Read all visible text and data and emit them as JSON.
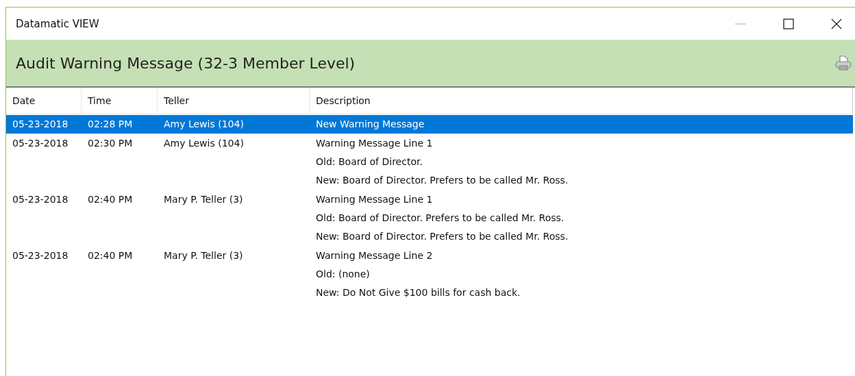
{
  "window": {
    "title": "Datamatic VIEW"
  },
  "header": {
    "title": "Audit Warning Message (32-3 Member Level)"
  },
  "table": {
    "columns": [
      "Date",
      "Time",
      "Teller",
      "Description"
    ],
    "rows": [
      {
        "date": "05-23-2018",
        "time": "02:28 PM",
        "teller": "Amy Lewis (104)",
        "description": [
          "New Warning Message"
        ],
        "selected": true
      },
      {
        "date": "05-23-2018",
        "time": "02:30 PM",
        "teller": "Amy Lewis (104)",
        "description": [
          "Warning Message Line 1",
          "Old: Board of Director.",
          "New: Board of Director. Prefers to be called Mr. Ross."
        ],
        "selected": false
      },
      {
        "date": "05-23-2018",
        "time": "02:40 PM",
        "teller": "Mary P. Teller (3)",
        "description": [
          "Warning Message Line 1",
          "Old: Board of Director. Prefers to be called Mr. Ross.",
          "New: Board of Director. Prefers to be called Mr. Ross."
        ],
        "selected": false
      },
      {
        "date": "05-23-2018",
        "time": "02:40 PM",
        "teller": "Mary P. Teller (3)",
        "description": [
          "Warning Message Line 2",
          "Old: (none)",
          "New: Do Not Give $100 bills for cash back."
        ],
        "selected": false
      }
    ]
  }
}
